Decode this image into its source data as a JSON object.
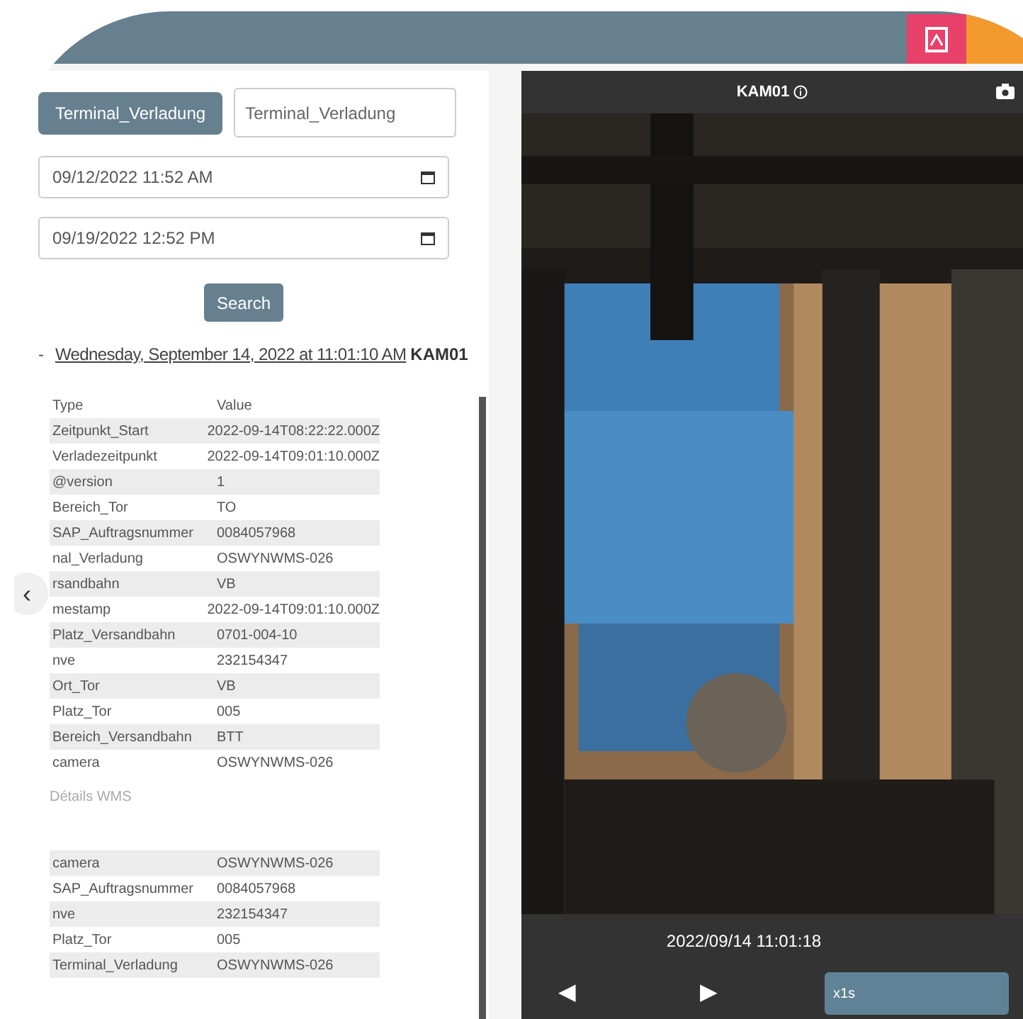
{
  "toolbar": {
    "buttons": [
      {
        "kind": "pdf"
      },
      {
        "kind": "orange"
      }
    ]
  },
  "filter": {
    "tag": "Terminal_Verladung",
    "field_value": "Terminal_Verladung",
    "date_from": "09/12/2022 11:52 AM",
    "date_to": "09/19/2022 12:52 PM",
    "search_button": "Search"
  },
  "event": {
    "toggle": "-",
    "title": "Wednesday, September 14, 2022 at 11:01:10 AM",
    "camera": "KAM01",
    "table": {
      "columns": [
        "Type",
        "Value"
      ],
      "rows": [
        {
          "type": "Zeitpunkt_Start",
          "value": "2022-09-14T08:22:22.000Z"
        },
        {
          "type": "Verladezeitpunkt",
          "value": "2022-09-14T09:01:10.000Z"
        },
        {
          "type": "@version",
          "value": "1"
        },
        {
          "type": "Bereich_Tor",
          "value": "TO"
        },
        {
          "type": "SAP_Auftragsnummer",
          "value": "0084057968"
        },
        {
          "type": "nal_Verladung",
          "value": "OSWYNWMS-026"
        },
        {
          "type": "rsandbahn",
          "value": "VB"
        },
        {
          "type": "mestamp",
          "value": "2022-09-14T09:01:10.000Z"
        },
        {
          "type": "Platz_Versandbahn",
          "value": "0701-004-10"
        },
        {
          "type": "nve",
          "value": "232154347"
        },
        {
          "type": "Ort_Tor",
          "value": "VB"
        },
        {
          "type": "Platz_Tor",
          "value": "005"
        },
        {
          "type": "Bereich_Versandbahn",
          "value": "BTT"
        },
        {
          "type": "camera",
          "value": "OSWYNWMS-026"
        }
      ]
    },
    "details_label": "Détails WMS",
    "details": [
      {
        "type": "camera",
        "value": "OSWYNWMS-026"
      },
      {
        "type": "SAP_Auftragsnummer",
        "value": "0084057968"
      },
      {
        "type": "nve",
        "value": "232154347"
      },
      {
        "type": "Platz_Tor",
        "value": "005"
      },
      {
        "type": "Terminal_Verladung",
        "value": "OSWYNWMS-026"
      }
    ]
  },
  "back_button": "‹",
  "camera_view": {
    "title": "KAM01",
    "timestamp": "2022/09/14 11:01:18",
    "prev": "◀",
    "next": "▶",
    "speed": "x1s"
  }
}
